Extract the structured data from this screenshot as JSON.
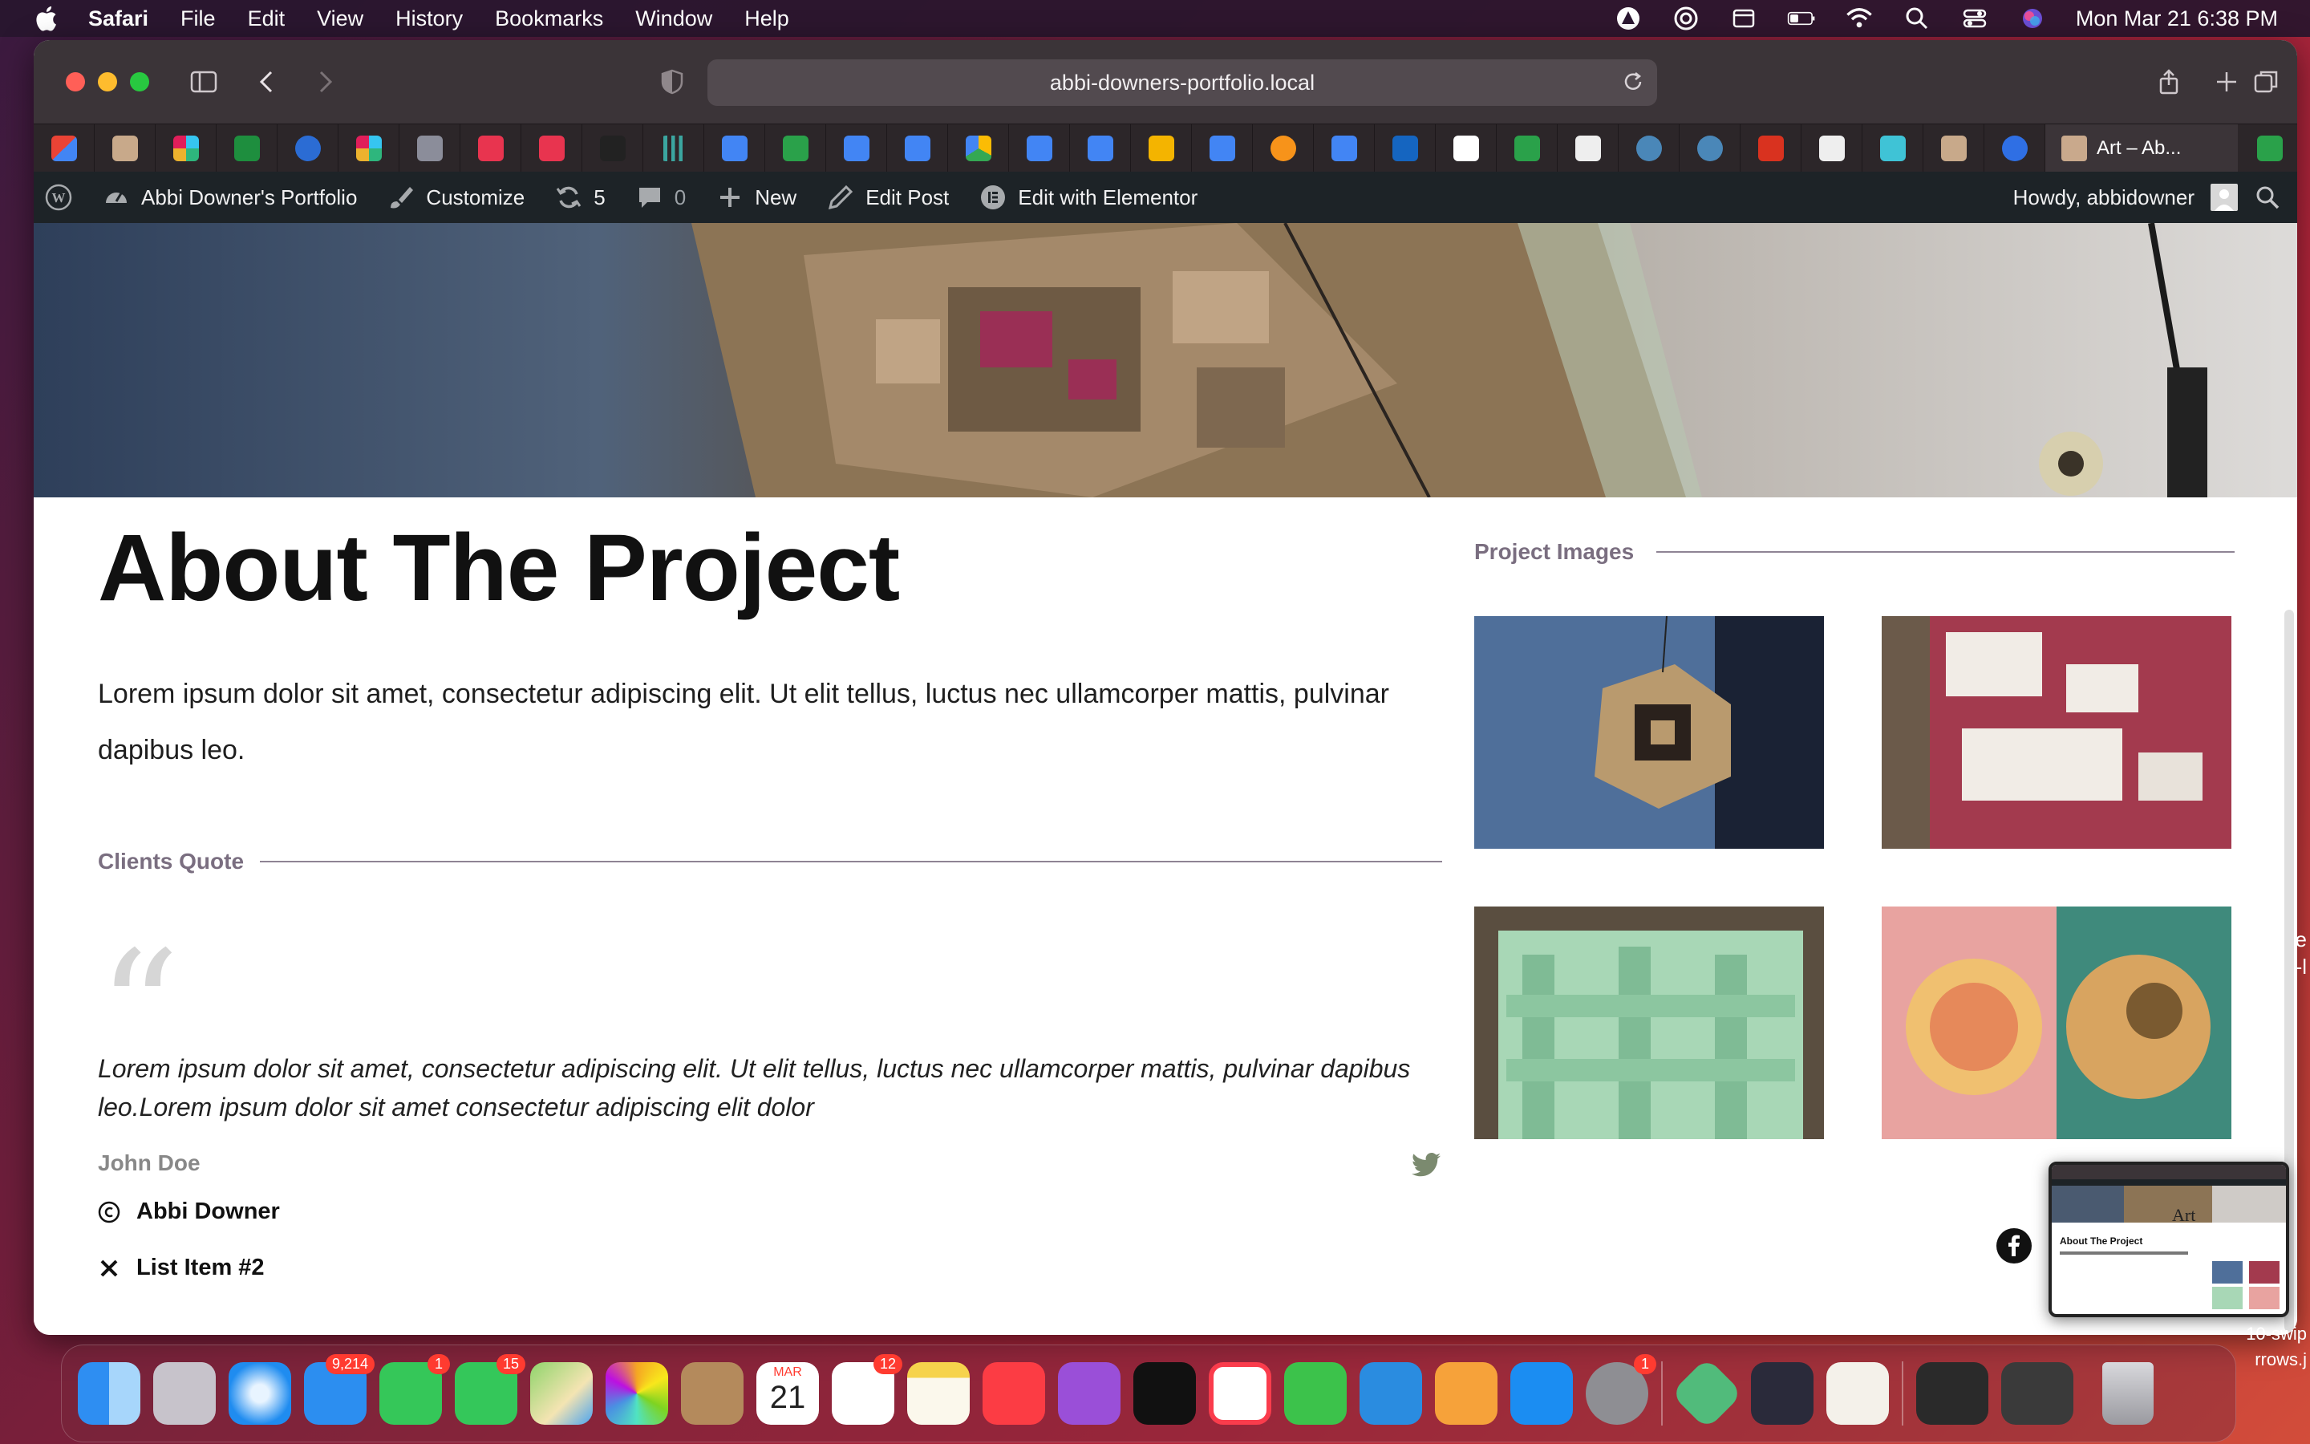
{
  "menubar": {
    "app": "Safari",
    "items": [
      "File",
      "Edit",
      "View",
      "History",
      "Bookmarks",
      "Window",
      "Help"
    ],
    "clock": "Mon Mar 21  6:38 PM"
  },
  "browser": {
    "url": "abbi-downers-portfolio.local",
    "active_tab": "Art – Ab..."
  },
  "wpbar": {
    "site": "Abbi Downer's Portfolio",
    "customize": "Customize",
    "updates": "5",
    "comments": "0",
    "new": "New",
    "edit_post": "Edit Post",
    "edit_elementor": "Edit with Elementor",
    "howdy": "Howdy, abbidowner"
  },
  "page": {
    "title": "About The Project",
    "lead": "Lorem ipsum dolor sit amet, consectetur adipiscing elit. Ut elit tellus, luctus nec ullamcorper mattis, pulvinar dapibus leo.",
    "quote_section": "Clients Quote",
    "quote": "Lorem ipsum dolor sit amet, consectetur adipiscing elit. Ut elit tellus, luctus nec ullamcorper mattis, pulvinar dapibus leo.Lorem ipsum dolor sit amet consectetur adipiscing elit dolor",
    "quote_author": "John Doe",
    "images_section": "Project Images",
    "list": [
      "Abbi Downer",
      "List Item #2"
    ]
  },
  "thumb": {
    "title": "About The Project",
    "art": "Art"
  },
  "dock": {
    "mail_badge": "9,214",
    "facetime_badge": "1",
    "messages_badge": "15",
    "calendar_month": "MAR",
    "calendar_day": "21",
    "reminders_badge": "12",
    "settings_badge": "1"
  },
  "desktop": {
    "file1": "e",
    "file2": "-l",
    "file3": "10-swip",
    "file4": "rrows.j"
  },
  "colors": {
    "wp_bar": "#1d2327",
    "section_label": "#7a6e80",
    "window_toolbar": "#3b3438"
  }
}
